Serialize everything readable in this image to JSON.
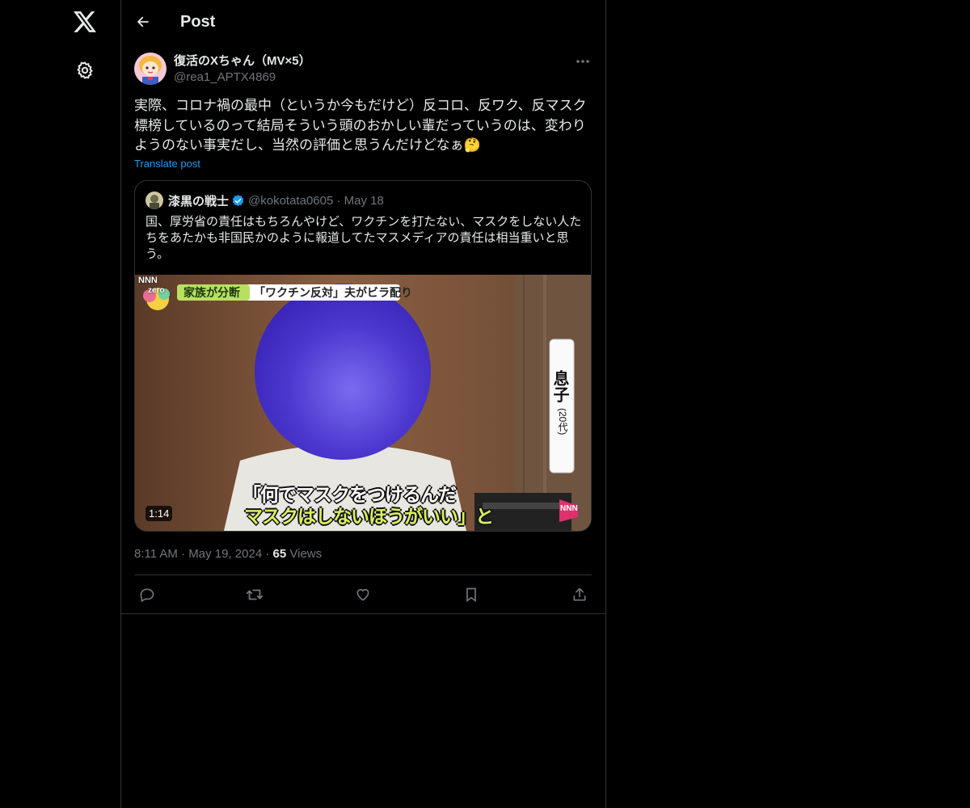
{
  "nav": {
    "logo_icon": "x-logo-icon",
    "settings_icon": "gear-icon"
  },
  "header": {
    "title": "Post",
    "back_icon": "arrow-left-icon"
  },
  "post": {
    "author_name": "復活のXちゃん（MV×5）",
    "author_handle": "@rea1_APTX4869",
    "text": "実際、コロナ禍の最中（というか今もだけど）反コロ、反ワク、反マスク標榜しているのって結局そういう頭のおかしい輩だっていうのは、変わりようのない事実だし、当然の評価と思うんだけどなぁ🤔",
    "translate_label": "Translate post",
    "time": "8:11 AM",
    "date": "May 19, 2024",
    "views_count": "65",
    "views_label": "Views"
  },
  "quote": {
    "name": "漆黒の戦士",
    "handle": "@kokotata0605",
    "date": "May 18",
    "text": "国、厚労省の責任はもちろんやけど、ワクチンを打たない、マスクをしない人たちをあたかも非国民かのように報道してたマスメディアの責任は相当重いと思う。",
    "video": {
      "duration": "1:14",
      "channel_logo": "NNN",
      "program_logo": "zero",
      "banner_left": "家族が分断",
      "banner_right": "「ワクチン反対」夫がビラ配り",
      "side_label_main": "息子",
      "side_label_sub": "(20代)",
      "subtitle_line1": "「何でマスクをつけるんだ",
      "subtitle_line2": "マスクはしないほうがいい」と",
      "corner_logo": "NNN"
    }
  },
  "actions": [
    "reply-icon",
    "repost-icon",
    "like-icon",
    "bookmark-icon",
    "share-icon"
  ],
  "colors": {
    "accent": "#1d9bf0",
    "background": "#000000",
    "border": "#2f3336",
    "muted": "#71767b"
  }
}
